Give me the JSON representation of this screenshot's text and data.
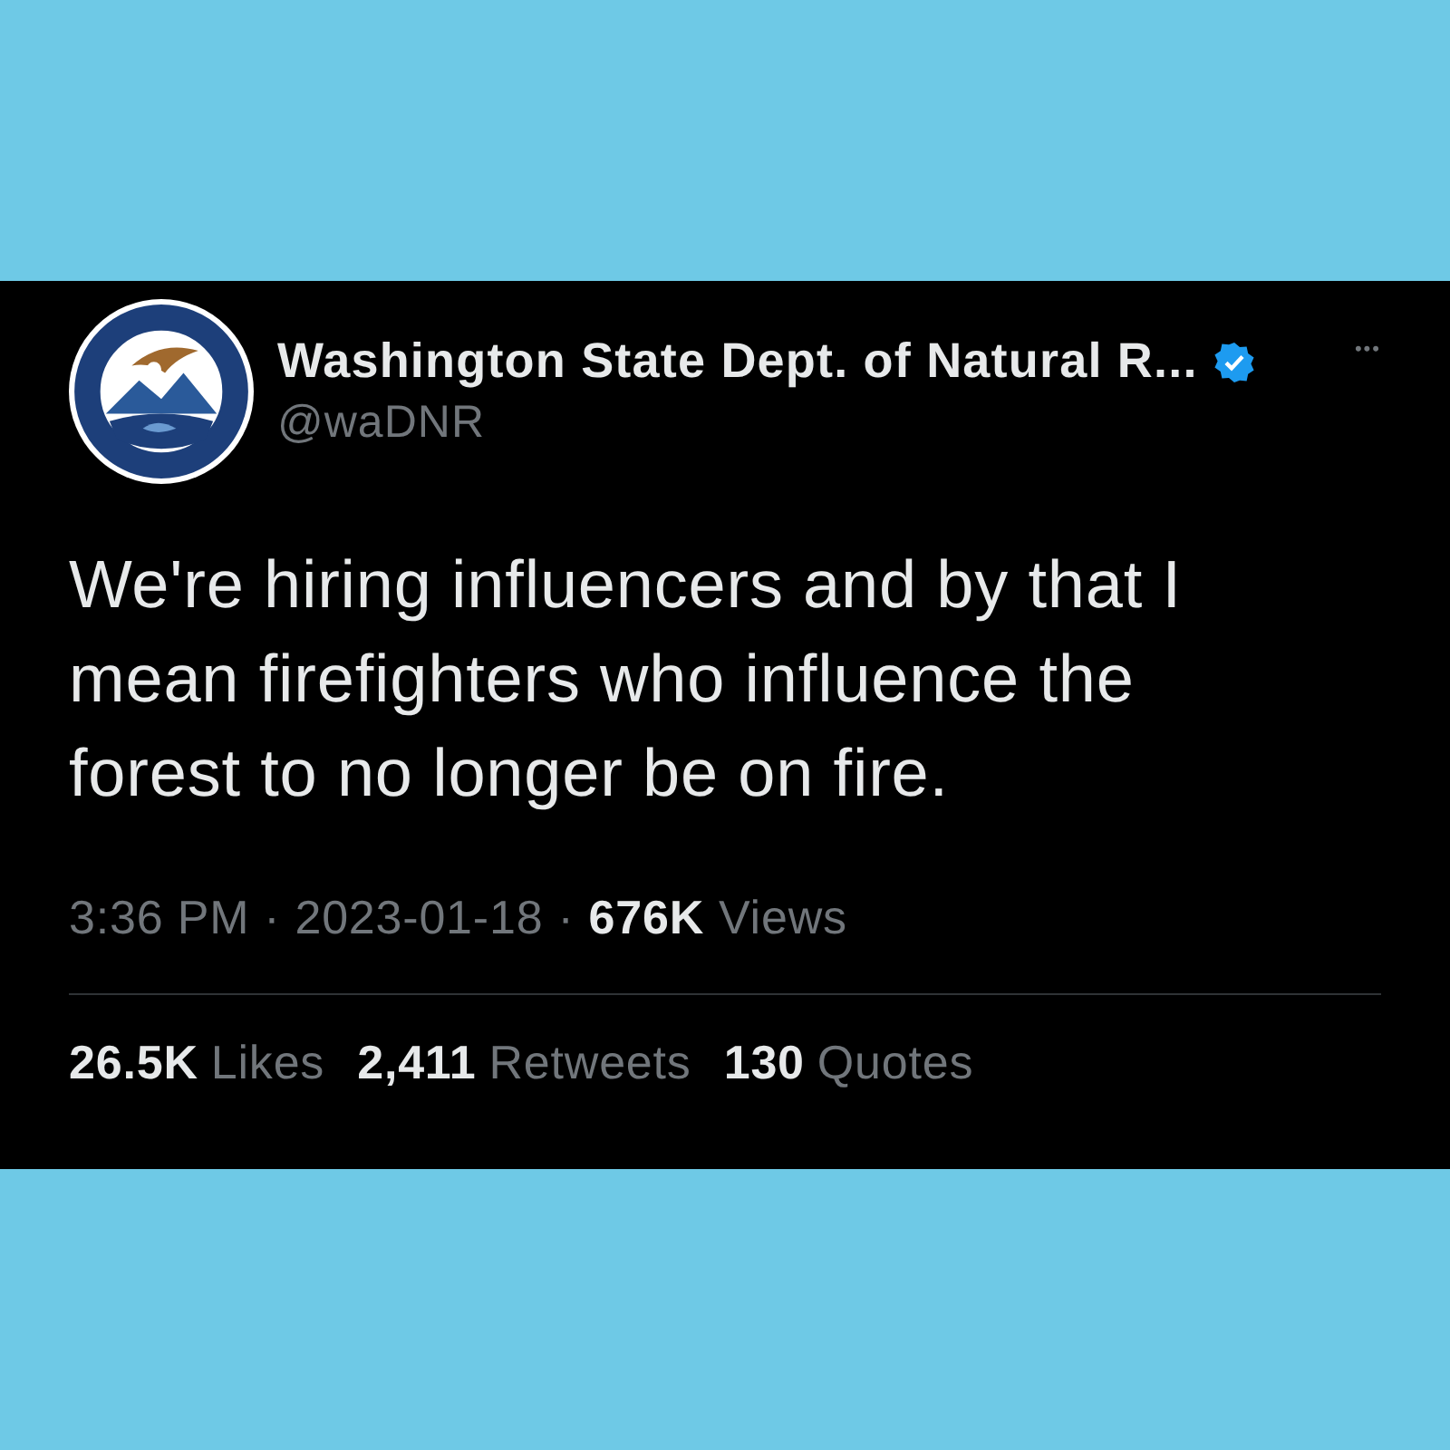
{
  "tweet": {
    "author": {
      "name": "Washington State Dept. of Natural R...",
      "handle": "@waDNR",
      "verified": true
    },
    "more": "•••",
    "text": "We're hiring influencers and by that I mean firefighters who influence the forest to no longer be on fire.",
    "meta": {
      "time": "3:36 PM",
      "separator_1": "·",
      "date": "2023-01-18",
      "separator_2": "·",
      "views_count": "676K",
      "views_label": "Views"
    },
    "stats": [
      {
        "count": "26.5K",
        "label": "Likes"
      },
      {
        "count": "2,411",
        "label": "Retweets"
      },
      {
        "count": "130",
        "label": "Quotes"
      }
    ]
  }
}
